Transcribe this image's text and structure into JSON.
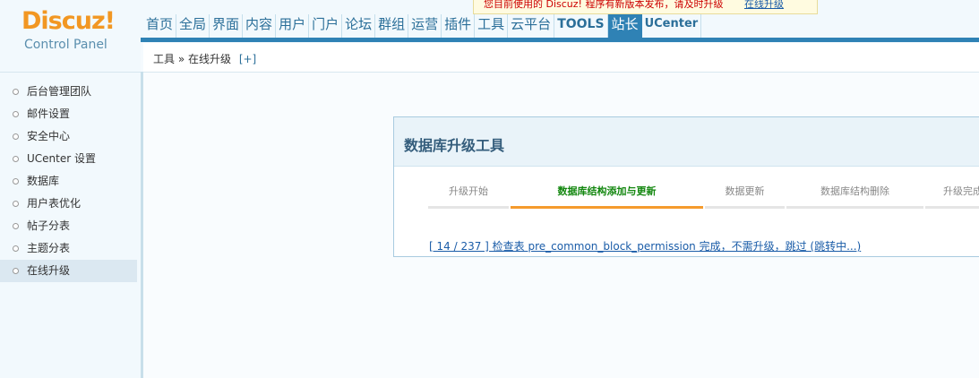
{
  "logo": {
    "title": "Discuz!",
    "subtitle": "Control Panel"
  },
  "notice": {
    "message": "您目前使用的 Discuz! 程序有新版本发布，请及时升级",
    "link": "在线升级"
  },
  "nav": {
    "items": [
      "首页",
      "全局",
      "界面",
      "内容",
      "用户",
      "门户",
      "论坛",
      "群组",
      "运营",
      "插件",
      "工具",
      "云平台",
      "TOOLS",
      "站长",
      "UCenter"
    ],
    "active": "站长"
  },
  "breadcrumb": {
    "path": "工具 » 在线升级",
    "toggle": "[+]"
  },
  "sidebar": {
    "items": [
      "后台管理团队",
      "邮件设置",
      "安全中心",
      "UCenter 设置",
      "数据库",
      "用户表优化",
      "帖子分表",
      "主题分表",
      "在线升级"
    ],
    "active": "在线升级"
  },
  "panel": {
    "title": "数据库升级工具",
    "steps": [
      "升级开始",
      "数据库结构添加与更新",
      "数据更新",
      "数据库结构删除",
      "升级完成"
    ],
    "active_step": "数据库结构添加与更新",
    "progress_text": "[ 14 / 237 ] 检查表 pre_common_block_permission 完成，不需升级，跳过 (跳转中...)"
  },
  "colors": {
    "brand_orange": "#f29722",
    "nav_blue": "#2f82b5",
    "active_step_green": "#13870f",
    "active_step_bar": "#f59b2d"
  }
}
